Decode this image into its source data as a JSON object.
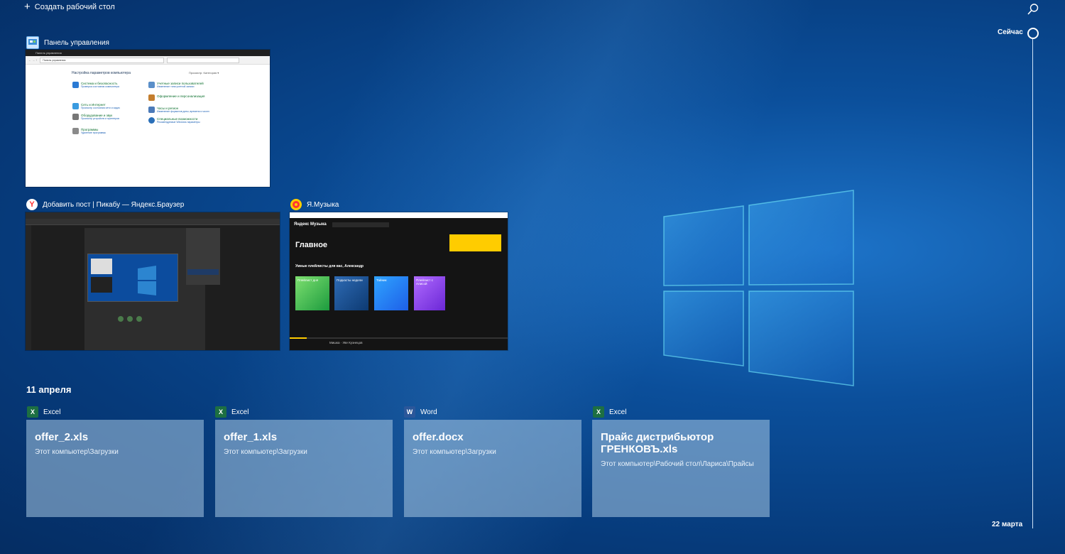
{
  "top": {
    "create_desktop": "Создать рабочий стол"
  },
  "timeline": {
    "now": "Сейчас",
    "end": "22 марта"
  },
  "activities": [
    {
      "app": "Панель управления",
      "icon": "control-panel-icon"
    },
    {
      "app": "Добавить пост | Пикабу — Яндекс.Браузер",
      "icon": "yandex-browser-icon"
    },
    {
      "app": "Я.Музыка",
      "icon": "yandex-music-icon"
    }
  ],
  "control_panel_thumb": {
    "window_title": "Панель управления",
    "path": "Панель управления",
    "header": "Настройка параметров компьютера",
    "view": "Просмотр: Категория ▾",
    "left": [
      {
        "title": "Система и безопасность",
        "sub": "Проверка состояния компьютера"
      },
      {
        "title": "Сеть и Интернет",
        "sub": "Просмотр состояния сети и задач"
      },
      {
        "title": "Оборудование и звук",
        "sub": "Просмотр устройств и принтеров"
      },
      {
        "title": "Программы",
        "sub": "Удаление программы"
      }
    ],
    "right": [
      {
        "title": "Учетные записи пользователей",
        "sub": "Изменение типа учетной записи"
      },
      {
        "title": "Оформление и персонализация",
        "sub": ""
      },
      {
        "title": "Часы и регион",
        "sub": "Изменение форматов даты, времени и чисел"
      },
      {
        "title": "Специальные возможности",
        "sub": "Рекомендуемые Windows параметры"
      }
    ]
  },
  "music_thumb": {
    "logo": "Яндекс Музыка",
    "heading": "Главное",
    "subheading": "Умные плейлисты для вас, Александр",
    "tiles": [
      "Плейлист дня",
      "Подкасты недели",
      "Тайник",
      "Плейлист с Алисой"
    ],
    "now_playing": "Мишка · Уве Кузнецов"
  },
  "section_date": "11 апреля",
  "documents": [
    {
      "app": "Excel",
      "icon": "excel-icon",
      "name": "offer_2.xls",
      "path": "Этот компьютер\\Загрузки"
    },
    {
      "app": "Excel",
      "icon": "excel-icon",
      "name": "offer_1.xls",
      "path": "Этот компьютер\\Загрузки"
    },
    {
      "app": "Word",
      "icon": "word-icon",
      "name": "offer.docx",
      "path": "Этот компьютер\\Загрузки"
    },
    {
      "app": "Excel",
      "icon": "excel-icon",
      "name": "Прайс дистрибьютор ГРЕНКОВЪ.xls",
      "path": "Этот компьютер\\Рабочий стол\\Лариса\\Прайсы"
    }
  ],
  "colors": {
    "excel": "#1d6f42",
    "word": "#2b579a",
    "yandex": "#f33",
    "music": "#ffcc00"
  }
}
